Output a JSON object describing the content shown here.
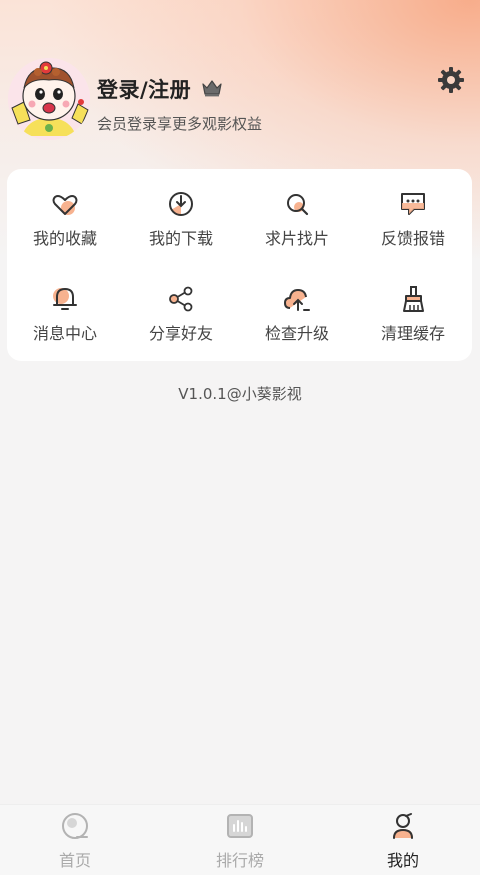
{
  "profile": {
    "title": "登录/注册",
    "subtitle": "会员登录享更多观影权益",
    "avatar": "cartoon-girl-avatar"
  },
  "actions": [
    {
      "label": "我的收藏",
      "icon": "heart-icon"
    },
    {
      "label": "我的下载",
      "icon": "download-icon"
    },
    {
      "label": "求片找片",
      "icon": "search-film-icon"
    },
    {
      "label": "反馈报错",
      "icon": "feedback-icon"
    },
    {
      "label": "消息中心",
      "icon": "bell-icon"
    },
    {
      "label": "分享好友",
      "icon": "share-icon"
    },
    {
      "label": "检查升级",
      "icon": "cloud-upload-icon"
    },
    {
      "label": "清理缓存",
      "icon": "broom-icon"
    }
  ],
  "version": "V1.0.1@小葵影视",
  "tabs": [
    {
      "label": "首页",
      "icon": "home-icon",
      "active": false
    },
    {
      "label": "排行榜",
      "icon": "ranking-icon",
      "active": false
    },
    {
      "label": "我的",
      "icon": "profile-icon",
      "active": true
    }
  ],
  "colors": {
    "accent": "#f5a47c",
    "header_gradient": "#f7aa87",
    "text_primary": "#222222",
    "tab_inactive": "#aaaaaa"
  }
}
